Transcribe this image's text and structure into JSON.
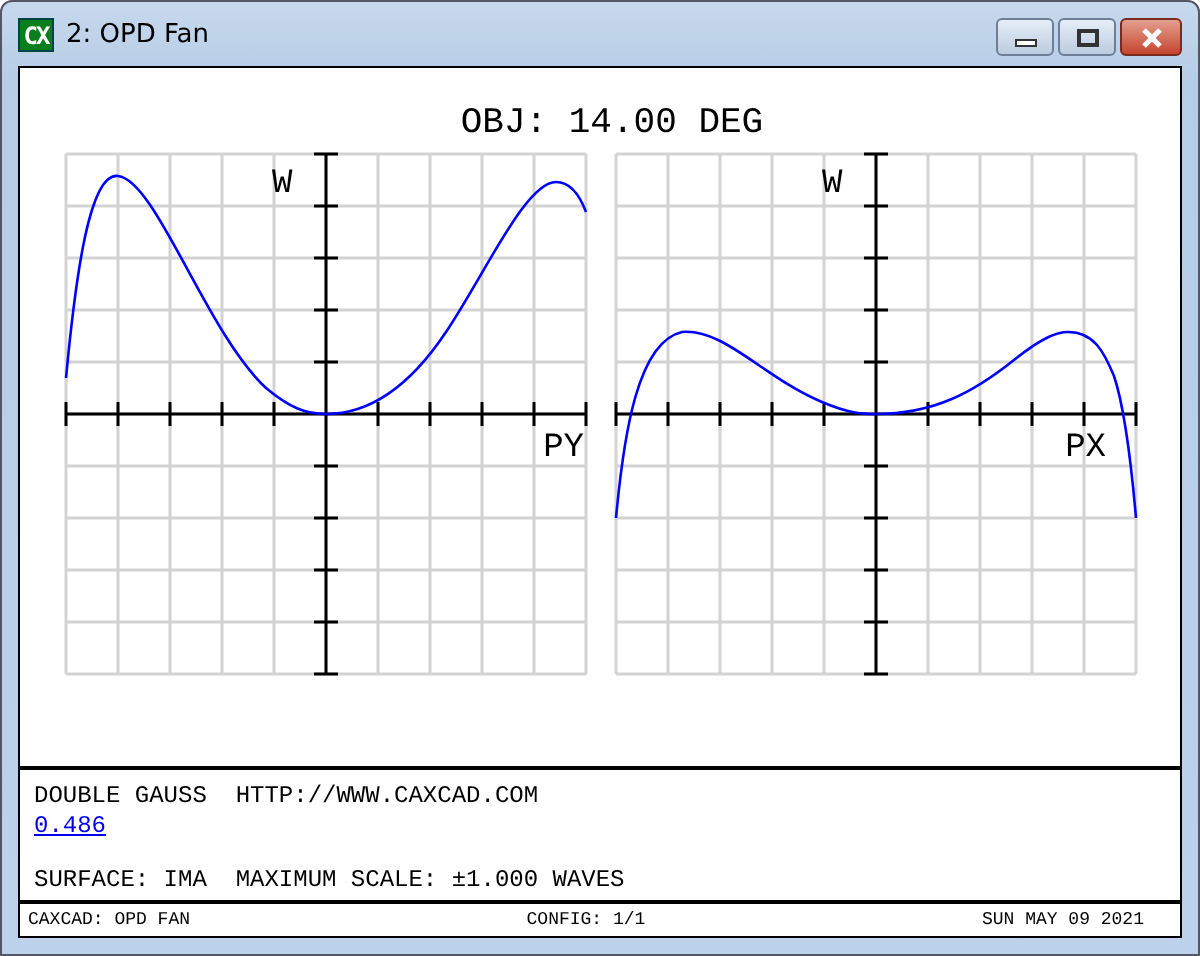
{
  "window": {
    "icon_text": "CX",
    "title": "2: OPD Fan"
  },
  "plot_title": "OBJ: 14.00 DEG",
  "plots": [
    {
      "y_label": "W",
      "x_label": "PY"
    },
    {
      "y_label": "W",
      "x_label": "PX"
    }
  ],
  "info": {
    "line_1": "DOUBLE GAUSS  HTTP://WWW.CAXCAD.COM",
    "wavelength_link": "0.486",
    "line_3": "SURFACE: IMA  MAXIMUM SCALE: ±1.000 WAVES"
  },
  "status_bar": [
    "CAXCAD: OPD FAN",
    "CONFIG: 1/1",
    "SUN MAY 09 2021"
  ]
}
